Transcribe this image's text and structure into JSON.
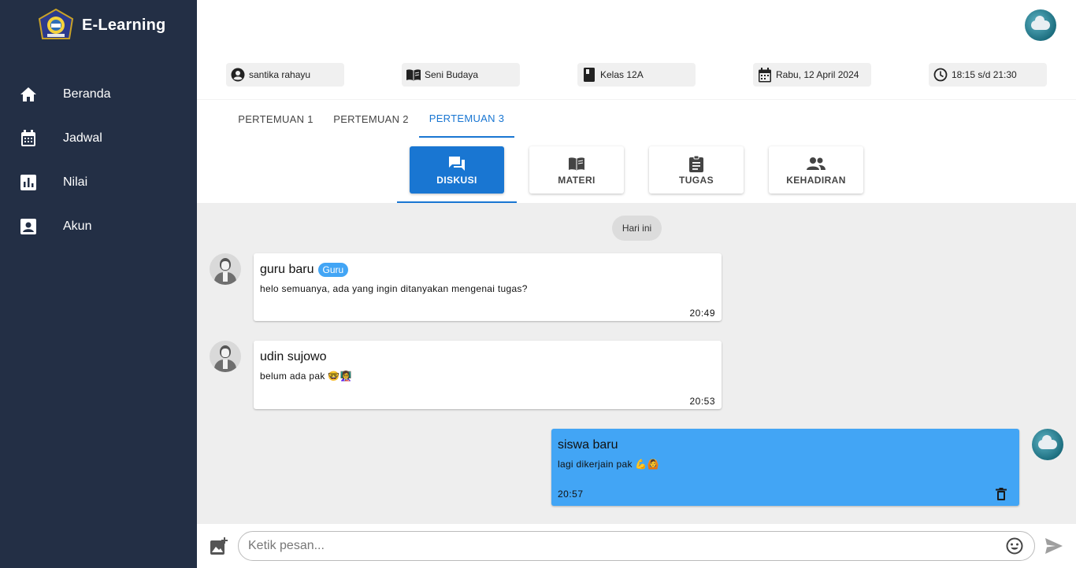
{
  "app": {
    "brand": "E-Learning"
  },
  "sidebar": {
    "items": [
      {
        "label": "Beranda",
        "icon": "home-icon"
      },
      {
        "label": "Jadwal",
        "icon": "calendar-icon"
      },
      {
        "label": "Nilai",
        "icon": "bar-chart-icon"
      },
      {
        "label": "Akun",
        "icon": "account-box-icon"
      }
    ]
  },
  "info": {
    "teacher": "santika rahayu",
    "subject": "Seni Budaya",
    "class": "Kelas 12A",
    "date": "Rabu, 12 April 2024",
    "time": "18:15 s/d 21:30"
  },
  "tabs": [
    {
      "label": "PERTEMUAN 1"
    },
    {
      "label": "PERTEMUAN 2"
    },
    {
      "label": "PERTEMUAN 3",
      "active": true
    }
  ],
  "subtabs": [
    {
      "label": "DISKUSI",
      "active": true
    },
    {
      "label": "MATERI"
    },
    {
      "label": "TUGAS"
    },
    {
      "label": "KEHADIRAN"
    }
  ],
  "chat": {
    "day_label": "Hari ini",
    "messages": [
      {
        "sender": "guru baru",
        "badge": "Guru",
        "text": "helo semuanya, ada yang ingin ditanyakan mengenai tugas?",
        "time": "20:49"
      },
      {
        "sender": "udin sujowo",
        "text": "belum ada pak 🤓👩‍🏫",
        "time": "20:53"
      },
      {
        "sender": "siswa baru",
        "text": "lagi dikerjain pak 💪🙆",
        "time": "20:57",
        "mine": true
      }
    ]
  },
  "composer": {
    "placeholder": "Ketik pesan..."
  },
  "colors": {
    "sidebar": "#232f45",
    "accent": "#1976d2",
    "mine_bubble": "#42a5f5",
    "chat_bg": "#eeeeee"
  }
}
